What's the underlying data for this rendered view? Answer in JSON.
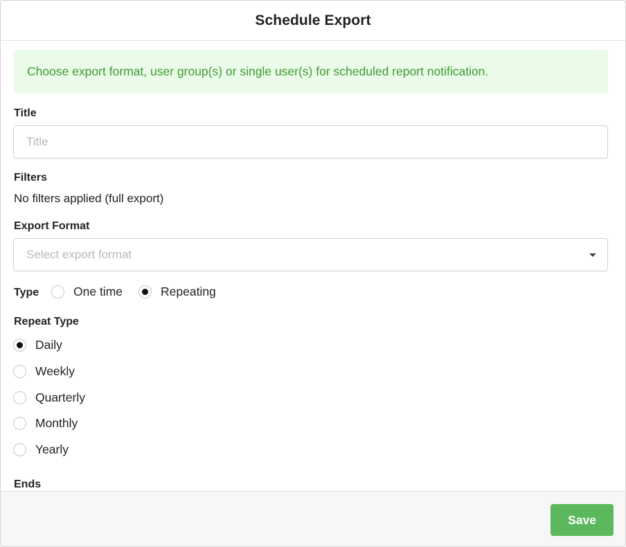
{
  "dialog": {
    "title": "Schedule Export"
  },
  "alert": {
    "message": "Choose export format, user group(s) or single user(s) for scheduled report notification."
  },
  "title_field": {
    "label": "Title",
    "value": "",
    "placeholder": "Title"
  },
  "filters": {
    "label": "Filters",
    "value": "No filters applied (full export)"
  },
  "export_format": {
    "label": "Export Format",
    "placeholder": "Select export format",
    "selected": ""
  },
  "type": {
    "label": "Type",
    "options": [
      {
        "label": "One time",
        "checked": false
      },
      {
        "label": "Repeating",
        "checked": true
      }
    ]
  },
  "repeat_type": {
    "label": "Repeat Type",
    "options": [
      {
        "label": "Daily",
        "checked": true
      },
      {
        "label": "Weekly",
        "checked": false
      },
      {
        "label": "Quarterly",
        "checked": false
      },
      {
        "label": "Monthly",
        "checked": false
      },
      {
        "label": "Yearly",
        "checked": false
      }
    ]
  },
  "ends": {
    "label": "Ends"
  },
  "footer": {
    "save_label": "Save"
  },
  "colors": {
    "alert_bg": "#eafbe9",
    "alert_text": "#3f9a2f",
    "save_button": "#5cb85c"
  }
}
